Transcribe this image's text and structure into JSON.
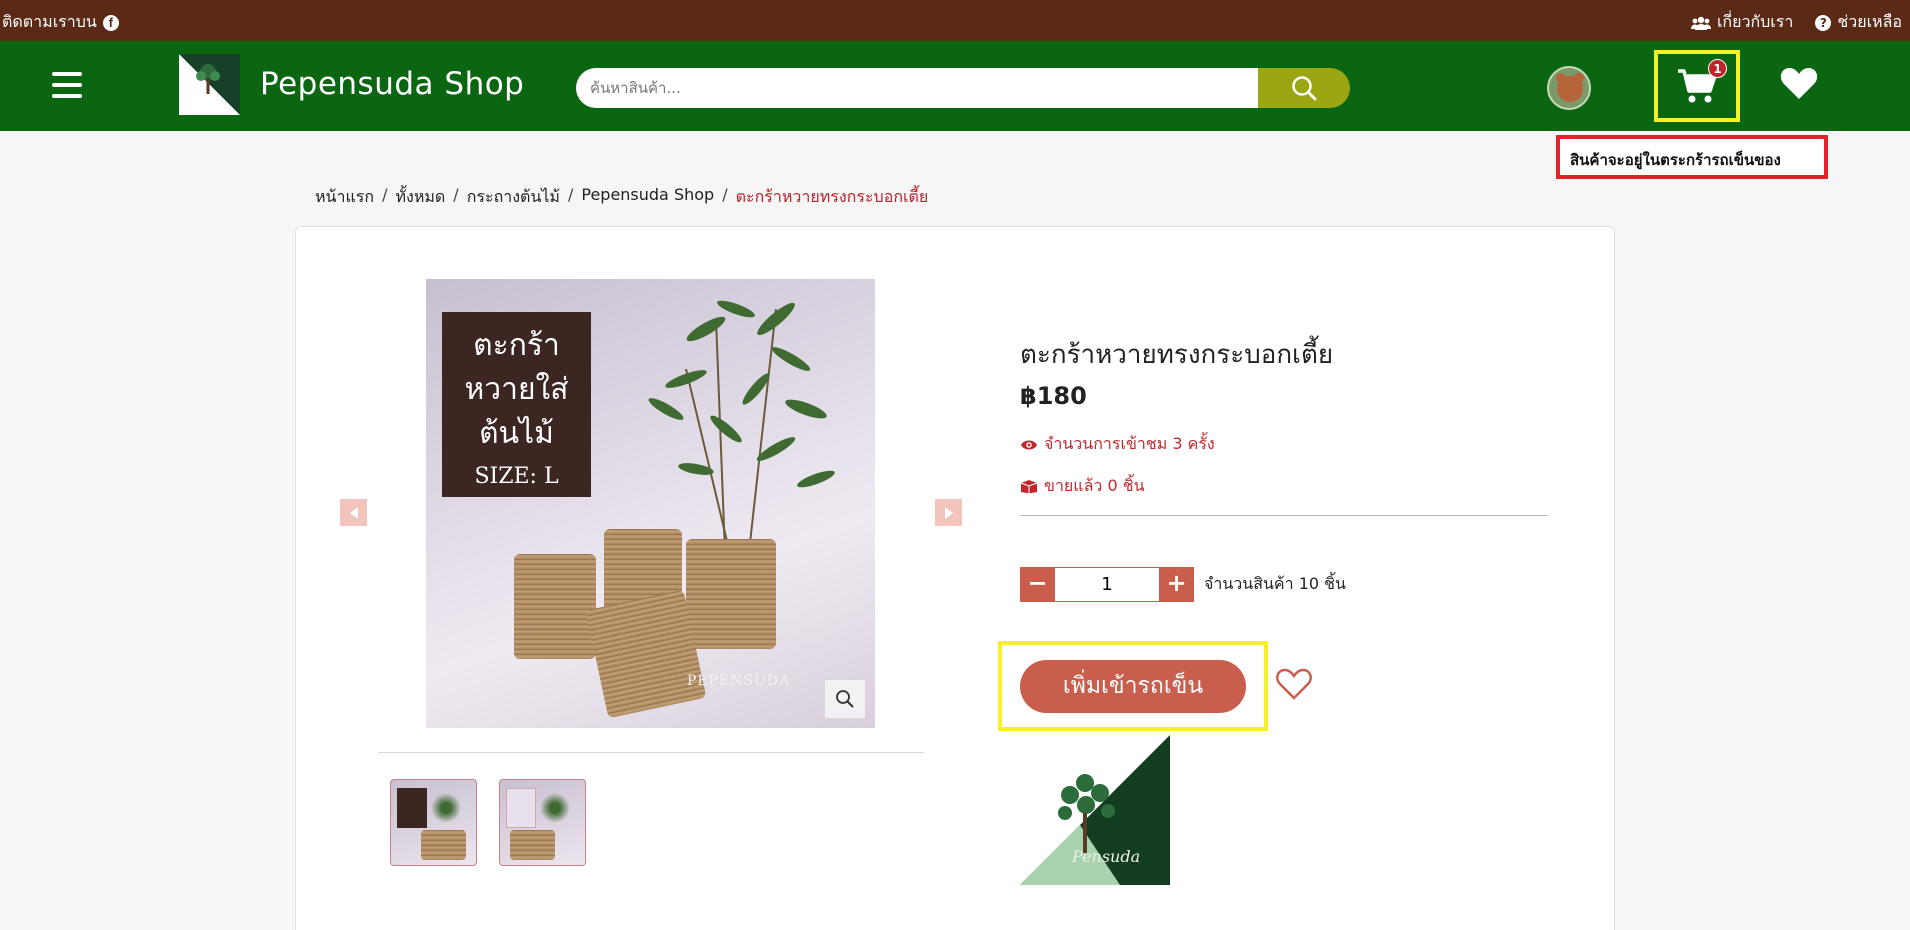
{
  "topbar": {
    "follow_text": "ติดตามเราบน",
    "about_text": "เกี่ยวกับเรา",
    "help_text": "ช่วยเหลือ"
  },
  "header": {
    "brand": "Pepensuda Shop",
    "search_placeholder": "ค้นหาสินค้า...",
    "cart_count": "1"
  },
  "tooltip": {
    "text": "สินค้าจะอยู่ในตระกร้ารถเข็นของ"
  },
  "breadcrumb": {
    "items": [
      "หน้าแรก",
      "ทั้งหมด",
      "กระถางต้นไม้",
      "Pepensuda Shop"
    ],
    "current": "ตะกร้าหวายทรงกระบอกเตี้ย"
  },
  "product": {
    "image_label_lines": [
      "ตะกร้า",
      "หวายใส่",
      "ต้นไม้"
    ],
    "image_size_label": "SIZE: L",
    "image_watermark": "PEPENSUDA",
    "title": "ตะกร้าหวายทรงกระบอกเตี้ย",
    "price": "฿180",
    "views": "จำนวนการเข้าชม 3 ครั้ง",
    "sold": "ขายแล้ว 0 ชิ้น",
    "quantity": "1",
    "stock": "จำนวนสินค้า 10 ชิ้น",
    "add_to_cart": "เพิ่มเข้ารถเข็น",
    "shop_logo_text": "Pensuda"
  },
  "colors": {
    "topbar": "#5a2a17",
    "header": "#0b6612",
    "accent": "#c95e4d",
    "highlight": "#f4f126",
    "tooltip_border": "#e4202c"
  },
  "icons": [
    "facebook-icon",
    "users-icon",
    "help-icon",
    "hamburger-icon",
    "search-icon",
    "cart-icon",
    "heart-icon",
    "eye-icon",
    "box-icon",
    "zoom-icon",
    "chevron-left-icon",
    "chevron-right-icon"
  ]
}
